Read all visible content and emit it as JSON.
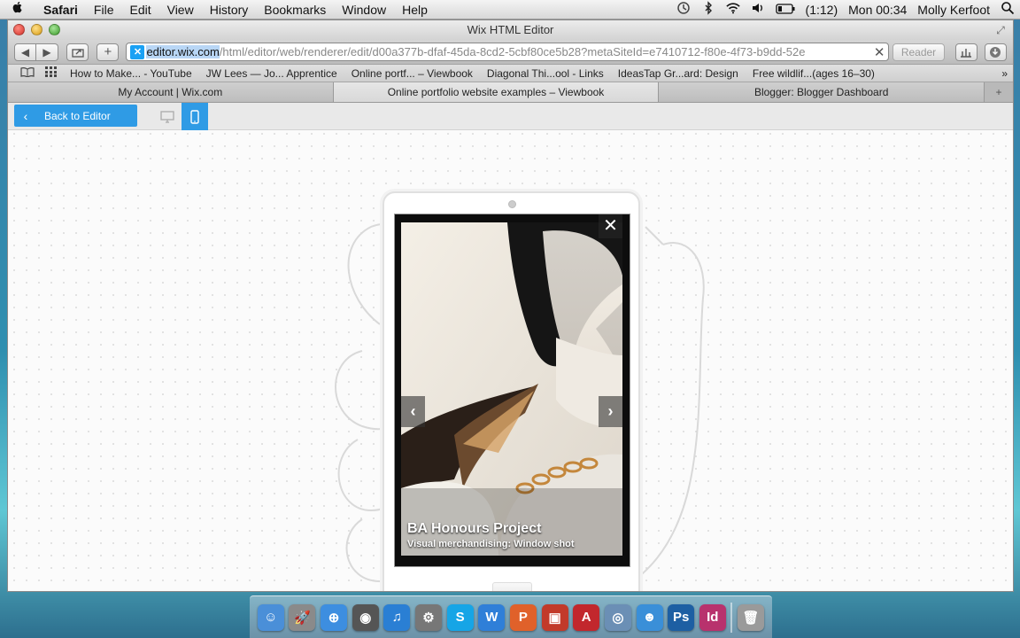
{
  "menubar": {
    "app_name": "Safari",
    "items": [
      "File",
      "Edit",
      "View",
      "History",
      "Bookmarks",
      "Window",
      "Help"
    ],
    "battery": "(1:12)",
    "clock": "Mon 00:34",
    "user": "Molly Kerfoot"
  },
  "window": {
    "title": "Wix HTML Editor"
  },
  "toolbar": {
    "address_domain": "editor.wix.com",
    "address_path": "/html/editor/web/renderer/edit/d00a377b-dfaf-45da-8cd2-5cbf80ce5b28?metaSiteId=e7410712-f80e-4f73-b9dd-52e",
    "reader_label": "Reader"
  },
  "bookmarks": [
    "How to Make... - YouTube",
    "JW Lees — Jo... Apprentice",
    "Online portf... – Viewbook",
    "Diagonal Thi...ool - Links",
    "IdeasTap Gr...ard: Design",
    "Free wildlif...(ages 16–30)"
  ],
  "tabs": [
    {
      "label": "My Account | Wix.com",
      "active": false
    },
    {
      "label": "Online portfolio website examples – Viewbook",
      "active": true
    },
    {
      "label": "Blogger: Blogger Dashboard",
      "active": false
    }
  ],
  "editor": {
    "back_label": "Back to Editor"
  },
  "gallery": {
    "title": "BA Honours Project",
    "subtitle": "Visual merchandising: Window shot"
  },
  "colors": {
    "wix_blue": "#2f9be5",
    "desktop_bg": "#2f8fb0"
  },
  "dock": [
    {
      "name": "finder-icon",
      "glyph": "☺",
      "color": "#4a8fd8"
    },
    {
      "name": "launchpad-icon",
      "glyph": "🚀",
      "color": "#8a8a8a"
    },
    {
      "name": "safari-icon",
      "glyph": "⊕",
      "color": "#3d8ee0"
    },
    {
      "name": "facetime-icon",
      "glyph": "◉",
      "color": "#555"
    },
    {
      "name": "itunes-icon",
      "glyph": "♫",
      "color": "#2a7fd4"
    },
    {
      "name": "system-preferences-icon",
      "glyph": "⚙",
      "color": "#777"
    },
    {
      "name": "skype-icon",
      "glyph": "S",
      "color": "#16a5e6"
    },
    {
      "name": "word-icon",
      "glyph": "W",
      "color": "#2f7fd8"
    },
    {
      "name": "powerpoint-icon",
      "glyph": "P",
      "color": "#e0612a"
    },
    {
      "name": "photo-booth-icon",
      "glyph": "▣",
      "color": "#c23a2a"
    },
    {
      "name": "acrobat-icon",
      "glyph": "A",
      "color": "#c2272d"
    },
    {
      "name": "messenger-icon",
      "glyph": "◎",
      "color": "#6b8fb5"
    },
    {
      "name": "messages-icon",
      "glyph": "☻",
      "color": "#3a8fd8"
    },
    {
      "name": "photoshop-icon",
      "glyph": "Ps",
      "color": "#1d5fa3"
    },
    {
      "name": "indesign-icon",
      "glyph": "Id",
      "color": "#b8326d"
    },
    {
      "name": "trash-icon",
      "glyph": "🗑",
      "color": "#9a9a9a"
    }
  ]
}
